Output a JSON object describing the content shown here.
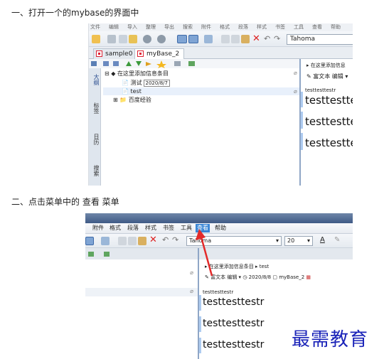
{
  "steps": [
    "一、打开一个的mybase的界面中",
    "二、点击菜单中的 查看 菜单"
  ],
  "shot1": {
    "font_name": "Tahoma",
    "tabs": [
      "sample0",
      "myBase_2"
    ],
    "sidebar": [
      "大纲",
      "标签",
      "日历",
      "搜索"
    ],
    "tree": {
      "root": "在这里添加信息条目",
      "child1": "测试",
      "child1_date": "2020/8/7",
      "child2": "test",
      "child3": "百度经验"
    },
    "right": {
      "breadcrumb": "在这里添加信息",
      "edit_label": "富文本 编辑",
      "small_text": "testtesttestr",
      "big_text": [
        "testtestte",
        "testtestte",
        "testtestte"
      ]
    }
  },
  "shot2": {
    "menu": [
      "附件",
      "格式",
      "段落",
      "样式",
      "书签",
      "工具",
      "查看",
      "帮助"
    ],
    "highlighted_menu": "查看",
    "font_name": "Tahoma",
    "font_size": "20",
    "breadcrumb": [
      "在这里添加信息条目",
      "test"
    ],
    "edit_label": "富文本 编辑",
    "date": "2020/8/8",
    "db_name": "myBase_2",
    "small_text": "testtesttestr",
    "big_text": [
      "testtesttestr",
      "testtesttestr",
      "testtesttestr"
    ]
  },
  "watermark": "最需教育",
  "colors": {
    "menu_highlight": "#3a86d6",
    "arrow": "#e32a2a",
    "watermark": "#1a23b8"
  }
}
